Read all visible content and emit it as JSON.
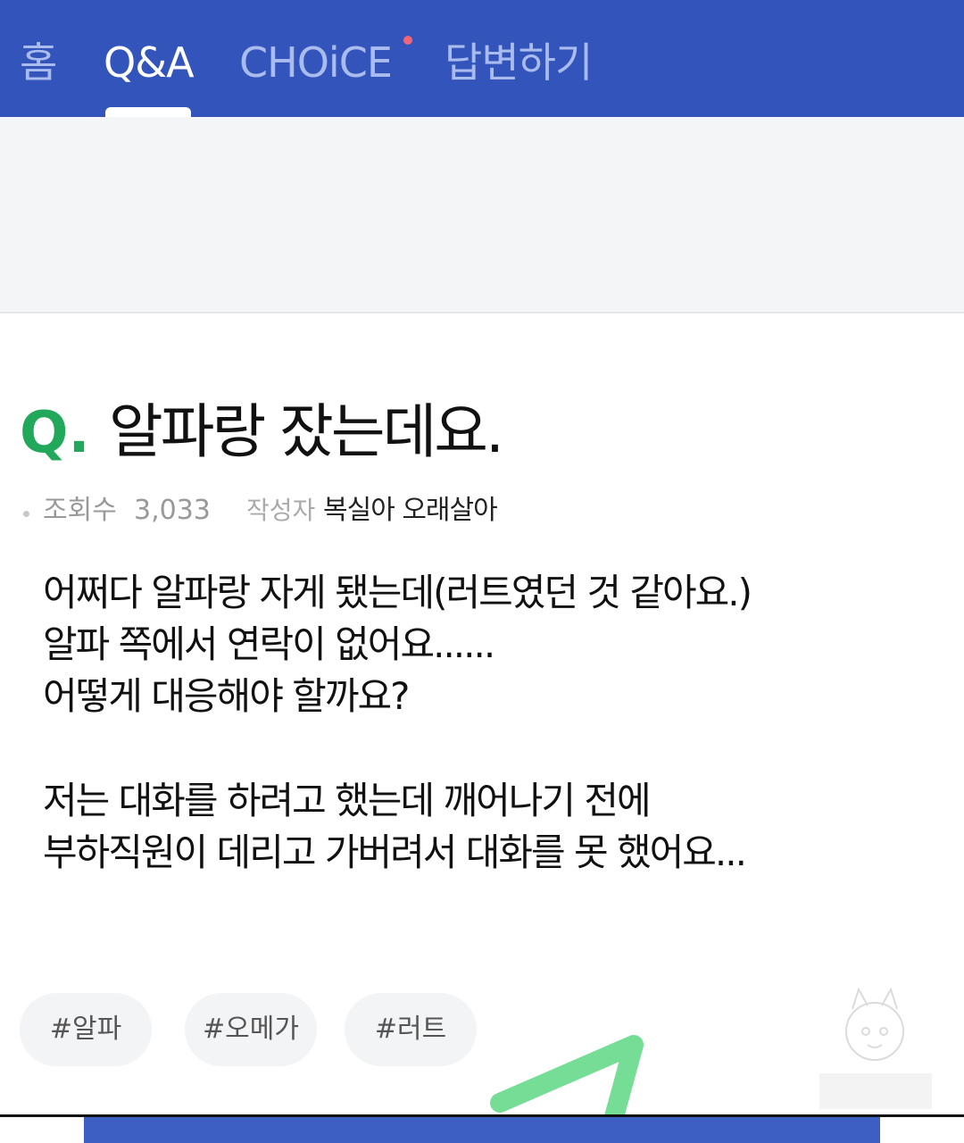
{
  "nav": {
    "tabs": [
      {
        "label": "홈",
        "active": false
      },
      {
        "label": "Q&A",
        "active": true
      },
      {
        "label": "CHOiCE",
        "active": false
      },
      {
        "label": "답변하기",
        "active": false
      }
    ],
    "choice_new_indicator": true
  },
  "question": {
    "mark": "Q.",
    "title": "알파랑 잤는데요.",
    "views_label": "조회수",
    "views": "3,033",
    "author_label": "작성자",
    "author": "복실아 오래살아",
    "body_para1": "어쩌다 알파랑 자게 됐는데(러트였던 것 같아요.)\n알파 쪽에서 연락이 없어요......\n어떻게 대응해야 할까요?",
    "body_para2": "저는 대화를 하려고 했는데 깨어나기 전에\n부하직원이 데리고 가버려서 대화를 못 했어요...",
    "tags": [
      "#알파",
      "#오메가",
      "#러트"
    ]
  },
  "colors": {
    "header_blue": "#3355bb",
    "accent_green": "#22a85a",
    "text_dark": "#111111",
    "meta_gray": "#999999"
  }
}
